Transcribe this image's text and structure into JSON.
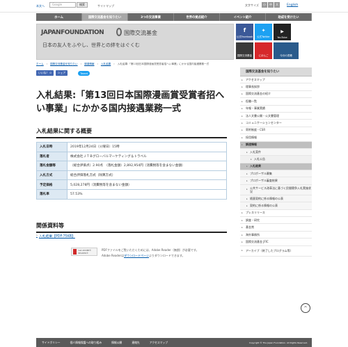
{
  "top": {
    "text_mode": "本文へ",
    "search_value": "Google",
    "search_button": "検索",
    "sitemap": "サイトマップ",
    "font_size_label": "文字サイズ",
    "size_small": "小",
    "size_medium": "中",
    "size_large": "大",
    "english": "English"
  },
  "nav": [
    "ホーム",
    "国際交流基金を知りたい",
    "3つの交流事業",
    "世界の拠点紹介",
    "イベント紹介",
    "助成を受けたい"
  ],
  "banner": {
    "logo": "JAPANFOUNDATION",
    "logo_jp": "国際交流基金",
    "tagline": "日本の友人をふやし、世界との絆をはぐくむ"
  },
  "social": [
    {
      "label": "公式Facebook",
      "color": "#3b5998"
    },
    {
      "label": "公式Twitter",
      "color": "#1da1f2"
    },
    {
      "label": "YouTube",
      "color": "#222222"
    },
    {
      "label": "国際交流基金",
      "color": "#3a3a3a"
    },
    {
      "label": "にほんご",
      "color": "#d6282b"
    },
    {
      "label": "今月の書籍",
      "color": "#2a5b8c"
    }
  ],
  "breadcrumb": [
    "ホーム",
    "国際交流基金を知りたい",
    "調達情報",
    "入札結果",
    "入札結果:「第13回日本国際漫画賞受賞者招へい事業」にかかる国内接遇業務一式"
  ],
  "share": {
    "like": "いいね！ 0",
    "share": "シェア",
    "tweet": "Tweet"
  },
  "page": {
    "title": "入札結果:「第13回日本国際漫画賞受賞者招へい事業」にかかる国内接遇業務一式",
    "overview_heading": "入札結果に関する概要",
    "rows": [
      {
        "label": "入札日時",
        "value": "2019年12月24日（火曜日）15時"
      },
      {
        "label": "落札者",
        "value": "株式会社ＪＴＢグローバルマーケティング＆トラベル"
      },
      {
        "label": "落札金額等",
        "value": "（総合評価点）2.90点　（落札金額）2,892,954円（消費税等を含まない金額）"
      },
      {
        "label": "入札方式",
        "value": "総合評価落札方式（除算方式）"
      },
      {
        "label": "予定価格",
        "value": "5,028,278円（消費税等を含まない金額）"
      },
      {
        "label": "落札率",
        "value": "57.53%"
      }
    ],
    "docs_heading": "関係資料等",
    "doc_link": "入札結果【PDF:75KB】",
    "pdf_note_1": "PDFファイルをご覧いただくためには、Adobe Reader（無償）が必要です。",
    "pdf_note_2a": "Adobe Readerは",
    "pdf_note_link": "ダウンロードページ",
    "pdf_note_2b": "よりダウンロードできます。",
    "adobe_badge": "Get ADOBE® READER®"
  },
  "sidebar": {
    "header": "国際交流基金を知りたい",
    "items": [
      {
        "label": "アクセスマップ",
        "level": 0
      },
      {
        "label": "理事長挨拶",
        "level": 0
      },
      {
        "label": "国際交流基金の紹介",
        "level": 0
      },
      {
        "label": "役職一覧",
        "level": 0
      },
      {
        "label": "年報・事業実績",
        "level": 0
      },
      {
        "label": "法人文書公開・公文書管理",
        "level": 0
      },
      {
        "label": "コミュニケーションセンター",
        "level": 0
      },
      {
        "label": "寄附制度・CSR",
        "level": 0
      },
      {
        "label": "採用情報",
        "level": 0
      },
      {
        "label": "調達情報",
        "level": 0,
        "selected": true
      },
      {
        "label": "入札案件",
        "level": 1
      },
      {
        "label": "入札公告",
        "level": 2
      },
      {
        "label": "入札結果",
        "level": 1,
        "selected": true
      },
      {
        "label": "プロポーザル募集",
        "level": 1
      },
      {
        "label": "プロポーザル審査結果",
        "level": 1
      },
      {
        "label": "公共サービス改革法に基づく民間競争入札実施状況",
        "level": 1,
        "two_line": true
      },
      {
        "label": "随意契約に係る情報の公表",
        "level": 1
      },
      {
        "label": "契約に係る情報の公表",
        "level": 1
      },
      {
        "label": "プレスリリース",
        "level": 0
      },
      {
        "label": "調査・研究",
        "level": 0
      },
      {
        "label": "基金賞",
        "level": 0
      },
      {
        "label": "海外事務所",
        "level": 0
      },
      {
        "label": "国際交流基金 JFIC",
        "level": 0
      },
      {
        "label": "アーカイブ（終了したプログラム等）",
        "level": 0,
        "two_line": true
      }
    ]
  },
  "footer": [
    "サイトポリシー",
    "個人情報保護への取り組み",
    "情報公開",
    "連絡先",
    "アクセスマップ"
  ],
  "copyright": "Copyright © The Japan Foundation. All Rights Reserved."
}
